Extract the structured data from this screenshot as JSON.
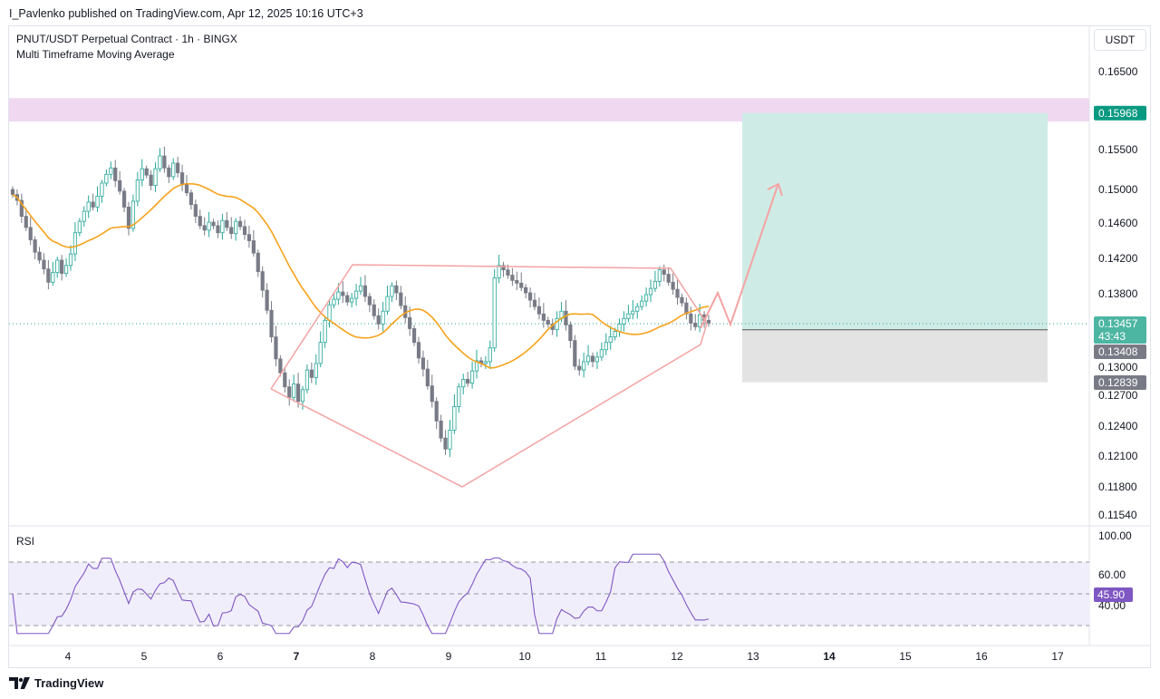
{
  "header": {
    "published": "I_Pavlenko published on TradingView.com, Apr 12, 2025 10:16 UTC+3"
  },
  "legend": {
    "symbol": "PNUT/USDT Perpetual Contract · 1h · BINGX",
    "indicator": "Multi Timeframe Moving Average"
  },
  "currency_button": "USDT",
  "rsi_label": "RSI",
  "brand": "TradingView",
  "chart_data": [
    {
      "type": "candlestick",
      "price_axis_ticks": [
        "0.16500",
        "0.15500",
        "0.15000",
        "0.14600",
        "0.14200",
        "0.13800",
        "0.13000",
        "0.12700",
        "0.12400",
        "0.12100",
        "0.11800",
        "0.11540"
      ],
      "price_tick_values": [
        0.165,
        0.155,
        0.15,
        0.146,
        0.142,
        0.138,
        0.13,
        0.127,
        0.124,
        0.121,
        0.118,
        0.1154
      ],
      "date_ticks": [
        "4",
        "5",
        "6",
        "7",
        "8",
        "9",
        "10",
        "11",
        "12",
        "13",
        "14",
        "15",
        "16",
        "17"
      ],
      "bold_date_ticks": [
        "7",
        "14"
      ],
      "badges": {
        "target": {
          "label": "0.15968",
          "color": "#089981"
        },
        "last_price": {
          "label": "0.13457",
          "countdown": "43:43",
          "color": "#4db6a3"
        },
        "entry": {
          "label": "0.13408",
          "color": "#787b86"
        },
        "stop": {
          "label": "0.12839",
          "color": "#787b86"
        }
      },
      "resistance_zone": {
        "from": 0.1586,
        "to": 0.1616,
        "color": "#f0d8f0"
      },
      "position": {
        "target": 0.15968,
        "entry": 0.13408,
        "stop": 0.12839,
        "profit_color": "#cfebe6",
        "loss_color": "#e3e3e3"
      },
      "candles_close": [
        0.1494,
        0.1487,
        0.1468,
        0.1455,
        0.1441,
        0.1427,
        0.1418,
        0.1408,
        0.1393,
        0.1404,
        0.1418,
        0.1403,
        0.1412,
        0.1425,
        0.1449,
        0.1462,
        0.1474,
        0.1485,
        0.1479,
        0.1492,
        0.1508,
        0.1519,
        0.1527,
        0.1511,
        0.1498,
        0.1479,
        0.1454,
        0.1486,
        0.1512,
        0.1526,
        0.1518,
        0.1505,
        0.1526,
        0.1542,
        0.1527,
        0.1516,
        0.1533,
        0.1521,
        0.1506,
        0.1496,
        0.1482,
        0.1468,
        0.1457,
        0.1452,
        0.1461,
        0.1457,
        0.1449,
        0.1463,
        0.1455,
        0.1448,
        0.1462,
        0.1456,
        0.1447,
        0.144,
        0.1426,
        0.1405,
        0.1384,
        0.1362,
        0.1333,
        0.1309,
        0.1294,
        0.1279,
        0.1268,
        0.1282,
        0.1264,
        0.1276,
        0.1297,
        0.1289,
        0.1304,
        0.1327,
        0.1351,
        0.1368,
        0.1374,
        0.1382,
        0.1378,
        0.1371,
        0.1375,
        0.1383,
        0.1389,
        0.1377,
        0.1368,
        0.1356,
        0.1347,
        0.1361,
        0.1377,
        0.1389,
        0.1381,
        0.1367,
        0.1354,
        0.1342,
        0.1327,
        0.131,
        0.1298,
        0.128,
        0.1264,
        0.1245,
        0.1228,
        0.1217,
        0.1236,
        0.1259,
        0.1279,
        0.1287,
        0.1283,
        0.1296,
        0.1307,
        0.1304,
        0.1306,
        0.1321,
        0.1398,
        0.1412,
        0.1407,
        0.1401,
        0.1395,
        0.1392,
        0.1387,
        0.1381,
        0.1373,
        0.1366,
        0.1358,
        0.1351,
        0.1347,
        0.1341,
        0.1353,
        0.1361,
        0.1346,
        0.1329,
        0.1301,
        0.1297,
        0.1306,
        0.1312,
        0.1306,
        0.1311,
        0.1319,
        0.1327,
        0.1333,
        0.1339,
        0.1347,
        0.1353,
        0.1358,
        0.1361,
        0.1366,
        0.1372,
        0.1379,
        0.1386,
        0.1394,
        0.1407,
        0.1402,
        0.1393,
        0.1385,
        0.1376,
        0.137,
        0.1358,
        0.1348,
        0.1344,
        0.1357,
        0.1351,
        0.1348
      ]
    },
    {
      "type": "line",
      "title": "RSI",
      "axis_ticks": [
        "100.00",
        "60.00",
        "40.00"
      ],
      "levels": {
        "upper": 70,
        "middle": 50,
        "lower": 30
      },
      "ylim": [
        0,
        100
      ],
      "current_value": "45.90",
      "value_color": "#7e57c2"
    }
  ],
  "colors": {
    "up": "#26a69a",
    "down": "#787b86",
    "ma": "#f7a21b",
    "pattern": "#f4a3a3",
    "rsi": "#7e57c2",
    "rsi_band": "#f1eefc"
  }
}
